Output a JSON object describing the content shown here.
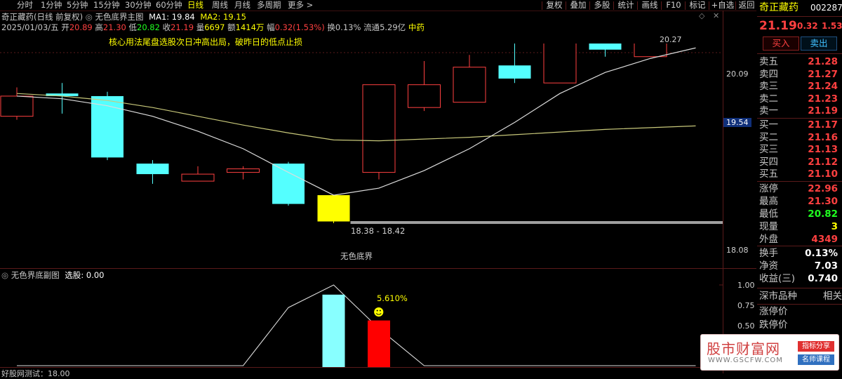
{
  "toolbar": {
    "periods": [
      "分时",
      "1分钟",
      "5分钟",
      "15分钟",
      "30分钟",
      "60分钟",
      "日线",
      "周线",
      "月线",
      "多周期",
      "更多 >"
    ],
    "active": "日线",
    "right_buttons": [
      "复权",
      "叠加",
      "多股",
      "统计",
      "画线",
      "F10",
      "标记",
      "+自选",
      "返回"
    ]
  },
  "chart_header": {
    "stock_name": "奇正藏药(日线 前复权)",
    "indicator": "无色底界主图",
    "ma1_label": "MA1: 19.84",
    "ma2_label": "MA2: 19.15",
    "date": "2025/01/03/五",
    "open_label": "开",
    "open": "20.89",
    "high_label": "高",
    "high": "21.30",
    "low_label": "低",
    "low": "20.82",
    "close_label": "收",
    "close": "21.19",
    "volume_label": "量",
    "volume": "6697",
    "amount_label": "额",
    "amount": "1414万",
    "range_label": "幅",
    "range": "0.32(1.53%)",
    "turnover_label": "换",
    "turnover": "0.13%",
    "float_label": "流通",
    "float": "5.29亿",
    "sector": "中药"
  },
  "annotation_text": "核心用法尾盘选股次日冲高出局，破昨日的低点止损",
  "price_axis": {
    "labels": [
      {
        "text": "20.09",
        "value": 20.09,
        "highlight": false
      },
      {
        "text": "19.54",
        "value": 19.54,
        "highlight": true
      },
      {
        "text": "18.08",
        "value": 18.08,
        "highlight": false
      }
    ]
  },
  "chart_labels": {
    "high_marker": "20.27",
    "zone_label": "18.38 - 18.42",
    "bottom_label": "无色底界"
  },
  "sub_chart": {
    "title": "无色界底副图",
    "select_label": "选股: 0.00",
    "percent": "5.610%",
    "axis": [
      {
        "text": "1.00",
        "value": 1.0
      },
      {
        "text": "0.75",
        "value": 0.75
      },
      {
        "text": "0.50",
        "value": 0.5
      }
    ],
    "bottom_text": "好股网测试：18.00"
  },
  "chart_data": {
    "type": "candlestick",
    "ylim": [
      18.08,
      20.45
    ],
    "candles": [
      {
        "o": 19.85,
        "c": 19.62,
        "h": 19.95,
        "l": 19.58,
        "dir": "up"
      },
      {
        "o": 19.88,
        "c": 19.85,
        "h": 20.0,
        "l": 19.65,
        "dir": "down"
      },
      {
        "o": 19.85,
        "c": 19.15,
        "h": 19.9,
        "l": 19.12,
        "dir": "down"
      },
      {
        "o": 19.08,
        "c": 18.96,
        "h": 19.12,
        "l": 18.85,
        "dir": "down"
      },
      {
        "o": 18.88,
        "c": 18.96,
        "h": 19.05,
        "l": 18.88,
        "dir": "up"
      },
      {
        "o": 18.98,
        "c": 19.02,
        "h": 19.05,
        "l": 18.9,
        "dir": "up"
      },
      {
        "o": 19.08,
        "c": 18.62,
        "h": 19.1,
        "l": 18.6,
        "dir": "down"
      },
      {
        "o": 18.72,
        "c": 18.42,
        "h": 18.72,
        "l": 18.4,
        "dir": "special"
      },
      {
        "o": 18.98,
        "c": 19.98,
        "h": 19.98,
        "l": 18.9,
        "dir": "up"
      },
      {
        "o": 19.98,
        "c": 19.72,
        "h": 20.25,
        "l": 19.68,
        "dir": "up"
      },
      {
        "o": 19.78,
        "c": 20.18,
        "h": 20.32,
        "l": 19.78,
        "dir": "up"
      },
      {
        "o": 20.2,
        "c": 20.05,
        "h": 20.45,
        "l": 20.0,
        "dir": "down"
      },
      {
        "o": 20.0,
        "c": 20.52,
        "h": 20.55,
        "l": 20.0,
        "dir": "up"
      },
      {
        "o": 20.5,
        "c": 20.38,
        "h": 20.55,
        "l": 20.3,
        "dir": "down"
      },
      {
        "o": 20.3,
        "c": 20.7,
        "h": 20.82,
        "l": 20.3,
        "dir": "up"
      },
      {
        "o": 20.78,
        "c": 20.52,
        "h": 20.85,
        "l": 20.52,
        "dir": "down"
      }
    ],
    "ma1": [
      19.85,
      19.82,
      19.74,
      19.62,
      19.45,
      19.25,
      18.98,
      18.72,
      18.8,
      19.0,
      19.25,
      19.55,
      19.88,
      20.12,
      20.28,
      20.4
    ],
    "ma2": [
      19.88,
      19.85,
      19.8,
      19.72,
      19.62,
      19.52,
      19.43,
      19.35,
      19.34,
      19.36,
      19.38,
      19.41,
      19.44,
      19.47,
      19.49,
      19.51
    ],
    "sub_values": [
      0,
      0,
      0,
      0,
      0,
      0,
      0.72,
      1.0,
      0.46,
      0,
      0,
      0,
      0,
      0,
      0,
      0
    ]
  },
  "right_panel": {
    "name": "奇正藏药",
    "code": "002287",
    "price": "21.19",
    "change": "0.32",
    "change_pct": "1.53",
    "buy_label": "买入",
    "sell_label": "卖出",
    "asks": [
      {
        "label": "卖五",
        "price": "21.28"
      },
      {
        "label": "卖四",
        "price": "21.27"
      },
      {
        "label": "卖三",
        "price": "21.24"
      },
      {
        "label": "卖二",
        "price": "21.23"
      },
      {
        "label": "卖一",
        "price": "21.19"
      }
    ],
    "bids": [
      {
        "label": "买一",
        "price": "21.17"
      },
      {
        "label": "买二",
        "price": "21.16"
      },
      {
        "label": "买三",
        "price": "21.13"
      },
      {
        "label": "买四",
        "price": "21.12"
      },
      {
        "label": "买五",
        "price": "21.10"
      }
    ],
    "stats": [
      {
        "label": "涨停",
        "value": "22.96",
        "color": "#ff4040"
      },
      {
        "label": "最高",
        "value": "21.30",
        "color": "#ff4040"
      },
      {
        "label": "最低",
        "value": "20.82",
        "color": "#20ff20"
      },
      {
        "label": "现量",
        "value": "3",
        "color": "#ffff00"
      },
      {
        "label": "外盘",
        "value": "4349",
        "color": "#ff4040"
      }
    ],
    "stats2": [
      {
        "label": "换手",
        "value": "0.13%",
        "color": "#ffffff"
      },
      {
        "label": "净资",
        "value": "7.03",
        "color": "#ffffff"
      },
      {
        "label": "收益(三)",
        "value": "0.740",
        "color": "#ffffff"
      }
    ],
    "bottom": {
      "market_label": "深市品种",
      "market_right": "相关",
      "limit_up": "涨停价",
      "limit_down": "跌停价"
    }
  },
  "watermark": {
    "title": "股市财富网",
    "url": "WWW.GSCFW.COM",
    "tag1": "指标分享",
    "tag2": "名师课程"
  },
  "colors": {
    "up": "#ff4040",
    "down": "#54ffff",
    "special": "#ffff00",
    "ma1": "#dcdcdc",
    "ma2": "#c8c87a",
    "sub_bar_up": "#ff0000",
    "sub_bar_down": "#88ffff"
  }
}
